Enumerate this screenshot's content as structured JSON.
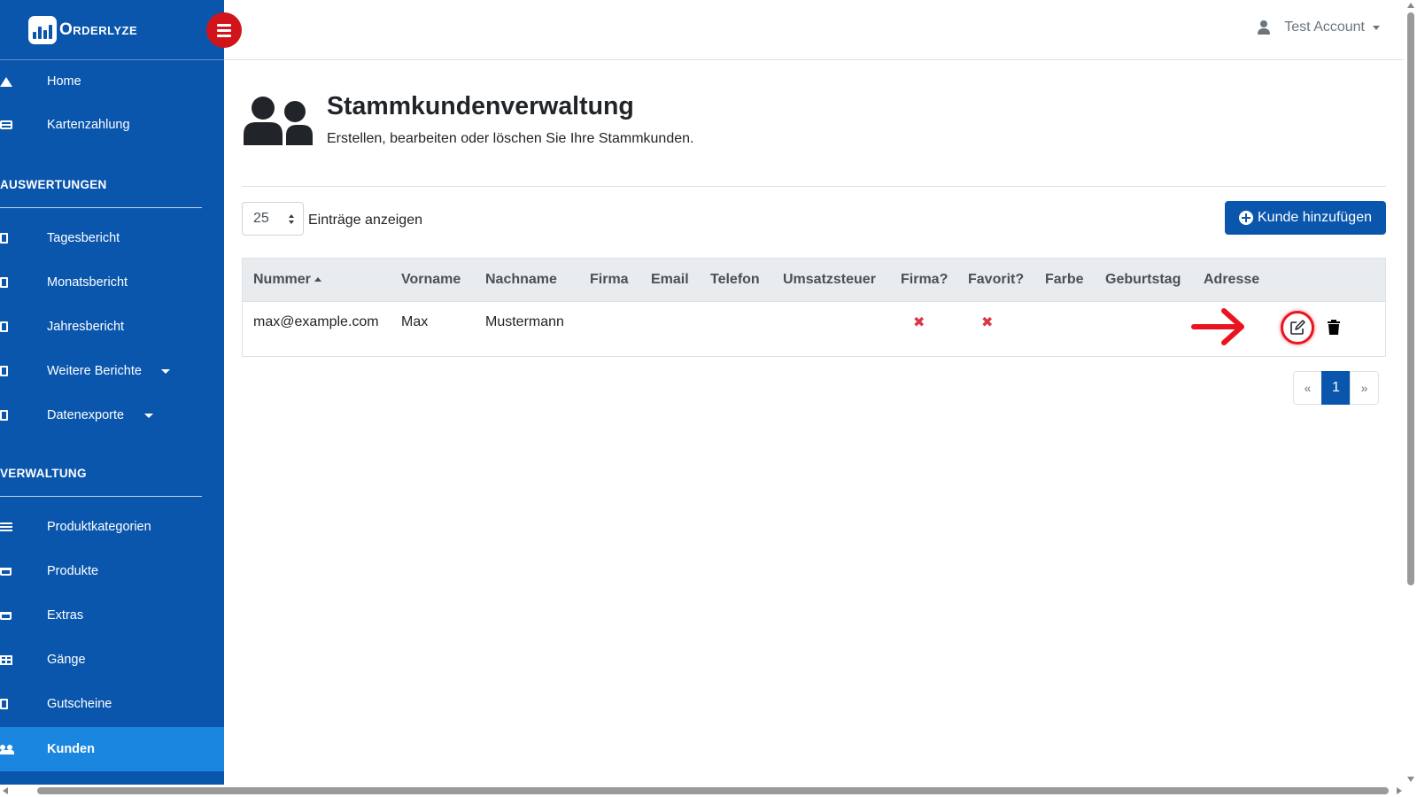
{
  "brand": {
    "name": "Orderlyze"
  },
  "account": {
    "name": "Test Account"
  },
  "sidebar": {
    "top_items": [
      {
        "label": "Home",
        "icon": "home-icon"
      },
      {
        "label": "Kartenzahlung",
        "icon": "credit-card-icon"
      }
    ],
    "sections": [
      {
        "title": "AUSWERTUNGEN",
        "items": [
          {
            "label": "Tagesbericht",
            "icon": "file-icon"
          },
          {
            "label": "Monatsbericht",
            "icon": "file-icon"
          },
          {
            "label": "Jahresbericht",
            "icon": "file-icon"
          },
          {
            "label": "Weitere Berichte",
            "icon": "file-icon",
            "has_dropdown": true
          },
          {
            "label": "Datenexporte",
            "icon": "file-icon",
            "has_dropdown": true
          }
        ]
      },
      {
        "title": "VERWALTUNG",
        "items": [
          {
            "label": "Produktkategorien",
            "icon": "list-icon"
          },
          {
            "label": "Produkte",
            "icon": "cart-icon"
          },
          {
            "label": "Extras",
            "icon": "cart-plus-icon"
          },
          {
            "label": "Gänge",
            "icon": "table-icon"
          },
          {
            "label": "Gutscheine",
            "icon": "file-icon"
          },
          {
            "label": "Kunden",
            "icon": "users-icon",
            "active": true
          }
        ]
      }
    ]
  },
  "page": {
    "title": "Stammkundenverwaltung",
    "subtitle": "Erstellen, bearbeiten oder löschen Sie Ihre Stammkunden."
  },
  "controls": {
    "page_length": "25",
    "page_length_label": "Einträge anzeigen",
    "add_button_label": "Kunde hinzufügen"
  },
  "table": {
    "columns": [
      "Nummer",
      "Vorname",
      "Nachname",
      "Firma",
      "Email",
      "Telefon",
      "Umsatzsteuer",
      "Firma?",
      "Favorit?",
      "Farbe",
      "Geburtstag",
      "Adresse"
    ],
    "sorted_column": "Nummer",
    "rows": [
      {
        "nummer": "max@example.com",
        "vorname": "Max",
        "nachname": "Mustermann",
        "firma": "",
        "email": "",
        "telefon": "",
        "umsatzsteuer": "",
        "firma_flag": "✖",
        "favorit_flag": "✖",
        "farbe": "",
        "geburtstag": "",
        "adresse": ""
      }
    ]
  },
  "pagination": {
    "prev": "«",
    "current": "1",
    "next": "»"
  },
  "colors": {
    "sidebar": "#0a56ad",
    "sidebar_active": "#1b86e0",
    "toggle": "#d1141c",
    "primary": "#0a56ad",
    "danger": "#dc3545",
    "annotation": "#e9141f"
  }
}
